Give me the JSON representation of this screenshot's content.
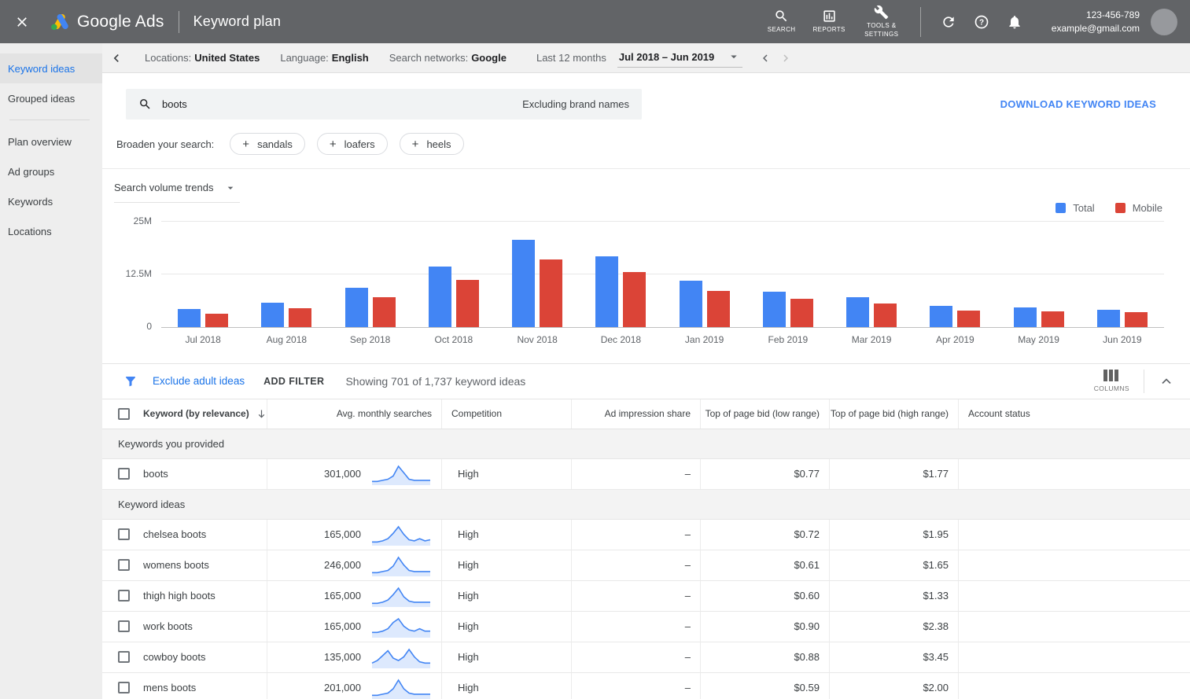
{
  "topbar": {
    "brand": "Google Ads",
    "title": "Keyword plan",
    "nav": [
      {
        "id": "search",
        "label": "SEARCH"
      },
      {
        "id": "reports",
        "label": "REPORTS"
      },
      {
        "id": "tools",
        "label": "TOOLS & SETTINGS"
      }
    ],
    "account_id": "123-456-789",
    "account_email": "example@gmail.com"
  },
  "subbar": {
    "locations_label": "Locations:",
    "locations_value": "United States",
    "language_label": "Language:",
    "language_value": "English",
    "networks_label": "Search networks:",
    "networks_value": "Google",
    "period_label": "Last 12 months",
    "date_range": "Jul 2018 – Jun 2019"
  },
  "sidebar": {
    "items": [
      {
        "label": "Keyword ideas",
        "active": true
      },
      {
        "label": "Grouped ideas",
        "active": false
      },
      {
        "divider": true
      },
      {
        "label": "Plan overview",
        "active": false
      },
      {
        "label": "Ad groups",
        "active": false
      },
      {
        "label": "Keywords",
        "active": false
      },
      {
        "label": "Locations",
        "active": false
      }
    ]
  },
  "search": {
    "query": "boots",
    "note": "Excluding brand names",
    "download_label": "DOWNLOAD KEYWORD IDEAS"
  },
  "broaden": {
    "label": "Broaden your search:",
    "chips": [
      "sandals",
      "loafers",
      "heels"
    ]
  },
  "chart_data": {
    "type": "bar",
    "title": "Search volume trends",
    "categories": [
      "Jul 2018",
      "Aug 2018",
      "Sep 2018",
      "Oct 2018",
      "Nov 2018",
      "Dec 2018",
      "Jan 2019",
      "Feb 2019",
      "Mar 2019",
      "Apr 2019",
      "May 2019",
      "Jun 2019"
    ],
    "series": [
      {
        "name": "Total",
        "color": "#4285f4",
        "values": [
          4.3,
          5.8,
          9.2,
          14.3,
          20.5,
          16.7,
          10.9,
          8.4,
          7.0,
          5.0,
          4.7,
          4.1
        ]
      },
      {
        "name": "Mobile",
        "color": "#db4437",
        "values": [
          3.2,
          4.4,
          7.1,
          11.1,
          16.0,
          13.0,
          8.6,
          6.6,
          5.5,
          3.9,
          3.7,
          3.5
        ]
      }
    ],
    "unit": "millions of searches",
    "ylim": [
      0,
      25
    ],
    "yticks": [
      "25M",
      "12.5M",
      "0"
    ],
    "grid": true,
    "legend_position": "top-right"
  },
  "filter_bar": {
    "exclude_link": "Exclude adult ideas",
    "add_filter": "ADD FILTER",
    "showing": "Showing 701 of 1,737 keyword ideas",
    "columns_label": "COLUMNS"
  },
  "table": {
    "columns": [
      {
        "label": "Keyword (by relevance)",
        "align": "left",
        "sorted": true
      },
      {
        "label": "Avg. monthly searches",
        "align": "right"
      },
      {
        "label": "Competition",
        "align": "left"
      },
      {
        "label": "Ad impression share",
        "align": "right"
      },
      {
        "label": "Top of page bid (low range)",
        "align": "right"
      },
      {
        "label": "Top of page bid (high range)",
        "align": "right"
      },
      {
        "label": "Account status",
        "align": "left"
      }
    ],
    "sections": [
      {
        "label": "Keywords you provided",
        "rows": [
          {
            "keyword": "boots",
            "avg_monthly_searches": "301,000",
            "sparkline": [
              2,
              2,
              3,
              4,
              7,
              16,
              10,
              4,
              3,
              3,
              3,
              3
            ],
            "competition": "High",
            "ad_impression_share": "–",
            "top_of_page_bid_low": "$0.77",
            "top_of_page_bid_high": "$1.77",
            "account_status": ""
          }
        ]
      },
      {
        "label": "Keyword ideas",
        "rows": [
          {
            "keyword": "chelsea boots",
            "avg_monthly_searches": "165,000",
            "sparkline": [
              2,
              2,
              3,
              5,
              10,
              16,
              9,
              4,
              3,
              5,
              3,
              4
            ],
            "competition": "High",
            "ad_impression_share": "–",
            "top_of_page_bid_low": "$0.72",
            "top_of_page_bid_high": "$1.95",
            "account_status": ""
          },
          {
            "keyword": "womens boots",
            "avg_monthly_searches": "246,000",
            "sparkline": [
              2,
              2,
              3,
              4,
              8,
              16,
              9,
              4,
              3,
              3,
              3,
              3
            ],
            "competition": "High",
            "ad_impression_share": "–",
            "top_of_page_bid_low": "$0.61",
            "top_of_page_bid_high": "$1.65",
            "account_status": ""
          },
          {
            "keyword": "thigh high boots",
            "avg_monthly_searches": "165,000",
            "sparkline": [
              2,
              2,
              3,
              5,
              10,
              16,
              8,
              4,
              3,
              3,
              3,
              3
            ],
            "competition": "High",
            "ad_impression_share": "–",
            "top_of_page_bid_low": "$0.60",
            "top_of_page_bid_high": "$1.33",
            "account_status": ""
          },
          {
            "keyword": "work boots",
            "avg_monthly_searches": "165,000",
            "sparkline": [
              3,
              3,
              4,
              6,
              11,
              14,
              8,
              5,
              4,
              6,
              4,
              4
            ],
            "competition": "High",
            "ad_impression_share": "–",
            "top_of_page_bid_low": "$0.90",
            "top_of_page_bid_high": "$2.38",
            "account_status": ""
          },
          {
            "keyword": "cowboy boots",
            "avg_monthly_searches": "135,000",
            "sparkline": [
              3,
              5,
              9,
              13,
              7,
              5,
              8,
              14,
              8,
              4,
              3,
              3
            ],
            "competition": "High",
            "ad_impression_share": "–",
            "top_of_page_bid_low": "$0.88",
            "top_of_page_bid_high": "$3.45",
            "account_status": ""
          },
          {
            "keyword": "mens boots",
            "avg_monthly_searches": "201,000",
            "sparkline": [
              2,
              2,
              3,
              4,
              8,
              16,
              8,
              4,
              3,
              3,
              3,
              3
            ],
            "competition": "High",
            "ad_impression_share": "–",
            "top_of_page_bid_low": "$0.59",
            "top_of_page_bid_high": "$2.00",
            "account_status": ""
          }
        ]
      }
    ]
  }
}
